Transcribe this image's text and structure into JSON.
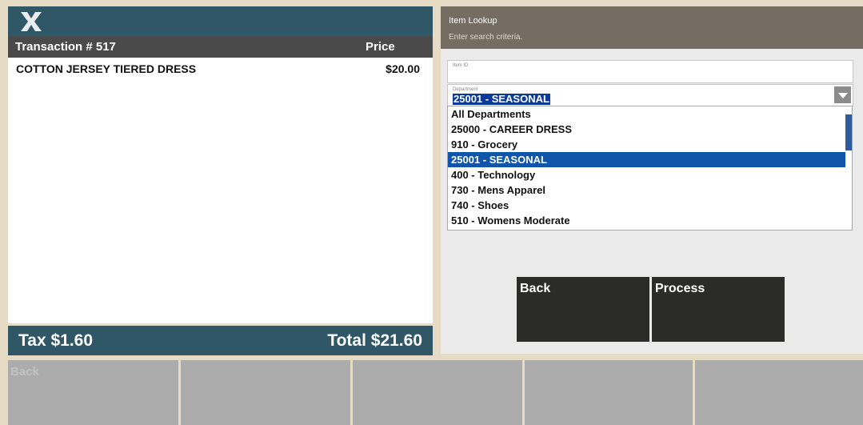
{
  "transaction": {
    "title": "Transaction # 517",
    "price_header": "Price",
    "items": [
      {
        "name": "COTTON JERSEY TIERED DRESS",
        "price": "$20.00"
      }
    ],
    "tax": "Tax $1.60",
    "total": "Total $21.60"
  },
  "lookup": {
    "title": "Item Lookup",
    "subtitle": "Enter search criteria.",
    "item_id_label": "Item ID",
    "department_label": "Department",
    "department_value": "25001 - SEASONAL",
    "departments": [
      "All Departments",
      "25000 - CAREER DRESS",
      "910 - Grocery",
      "25001 - SEASONAL",
      "400 - Technology",
      "730 - Mens Apparel",
      "740 - Shoes",
      "510 - Womens Moderate"
    ],
    "selected_index": 3,
    "back_label": "Back",
    "process_label": "Process"
  },
  "bottom": {
    "tiles": [
      "Back",
      "",
      "",
      "",
      ""
    ]
  },
  "colors": {
    "header_teal": "#305765",
    "lookup_header": "#756d61",
    "selection_blue": "#1155a8",
    "button_dark": "#2b2b29"
  }
}
